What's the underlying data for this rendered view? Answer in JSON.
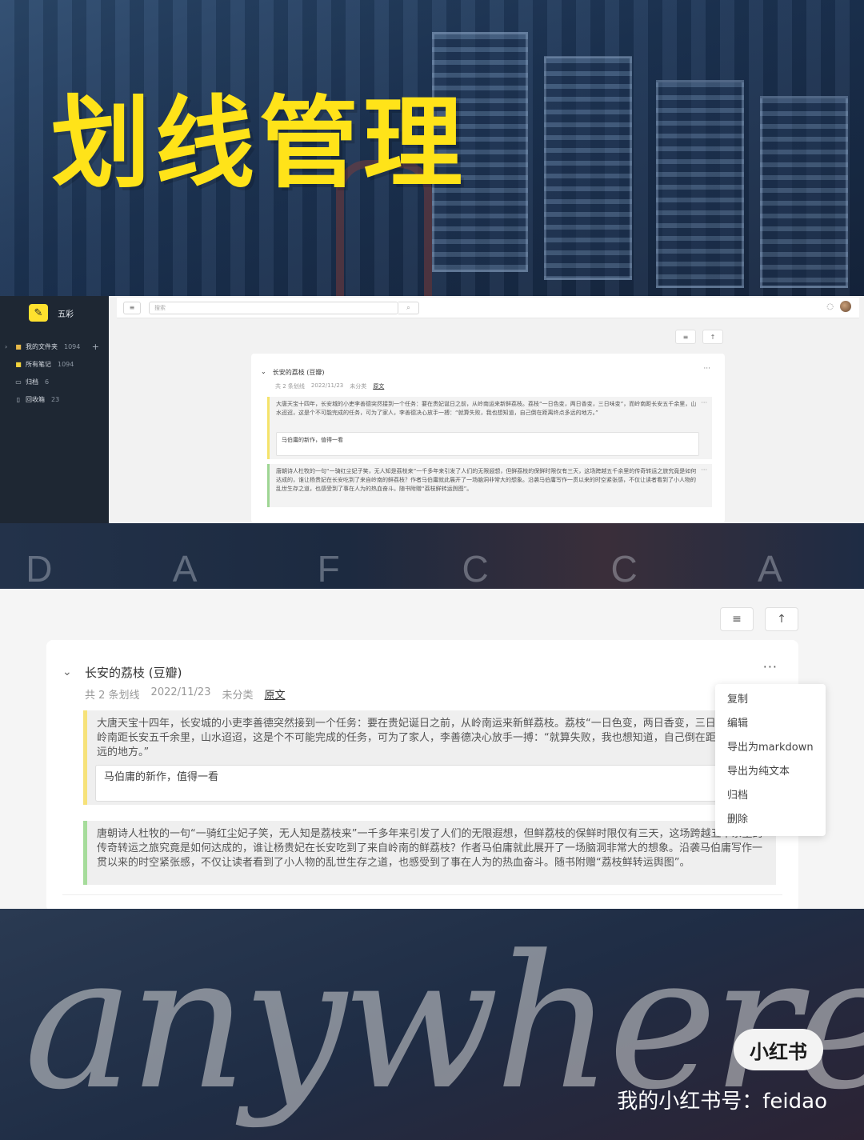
{
  "overlay": {
    "title": "划线管理",
    "script_word": "anywhere.",
    "mid_letters": "D A F C C A",
    "badge": "小红书",
    "account": "我的小红书号：feidao"
  },
  "sidebar": {
    "app_name": "五彩",
    "items": [
      {
        "label": "我的文件夹",
        "count": "1094",
        "icon": "folder-icon"
      },
      {
        "label": "所有笔记",
        "count": "1094",
        "icon": "note-icon"
      },
      {
        "label": "归档",
        "count": "6",
        "icon": "archive-icon"
      },
      {
        "label": "回收箱",
        "count": "23",
        "icon": "trash-icon"
      }
    ]
  },
  "topbar": {
    "search_placeholder": "搜索"
  },
  "toolbar": {
    "list_icon": "≡",
    "export_icon": "↑"
  },
  "card": {
    "title": "长安的荔枝 (豆瓣)",
    "meta_count": "共 2 条划线",
    "meta_date": "2022/11/23",
    "meta_category": "未分类",
    "meta_link": "原文",
    "highlight1": "大唐天宝十四年，长安城的小吏李善德突然接到一个任务：要在贵妃诞日之前，从岭南运来新鲜荔枝。荔枝“一日色变，两日香变，三日味变”，而岭南距长安五千余里，山水迢迢，这是个不可能完成的任务，可为了家人，李善德决心放手一搏：“就算失败，我也想知道，自己倒在距离终点多远的地方。”",
    "note1": "马伯庸的新作，值得一看",
    "highlight2": "唐朝诗人杜牧的一句“一骑红尘妃子笑，无人知是荔枝来”一千多年来引发了人们的无限遐想，但鲜荔枝的保鲜时限仅有三天，这场跨越五千余里的传奇转运之旅究竟是如何达成的，谁让杨贵妃在长安吃到了来自岭南的鲜荔枝？作者马伯庸就此展开了一场脑洞非常大的想象。沿袭马伯庸写作一贯以来的时空紧张感，不仅让读者看到了小人物的乱世生存之道，也感受到了事在人为的热血奋斗。随书附赠“荔枝鲜转运舆图”。"
  },
  "menu": {
    "items": [
      "复制",
      "编辑",
      "导出为markdown",
      "导出为纯文本",
      "归档",
      "删除"
    ]
  }
}
